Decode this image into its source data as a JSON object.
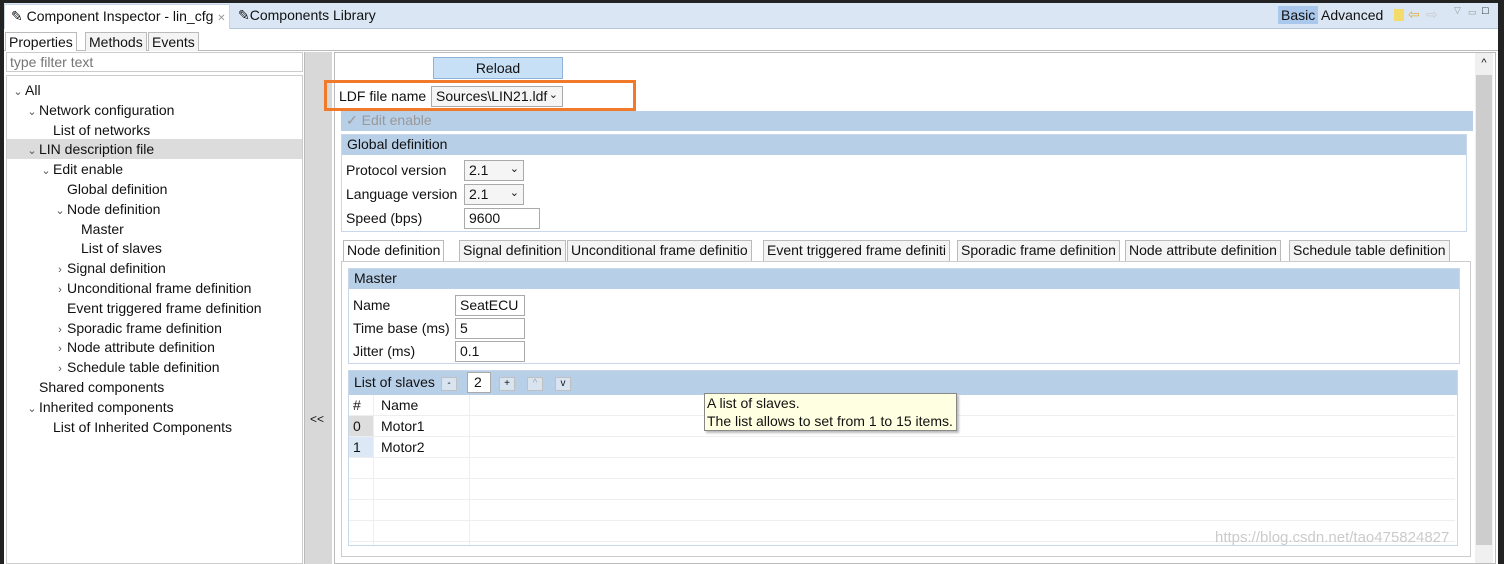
{
  "tabs": {
    "inspector": "Component Inspector - lin_cfg",
    "library": "Components Library",
    "basic": "Basic",
    "advanced": "Advanced"
  },
  "prop_tabs": [
    "Properties",
    "Methods",
    "Events"
  ],
  "filter_placeholder": "type filter text",
  "tree": [
    {
      "label": "All",
      "depth": 0,
      "caret": "v"
    },
    {
      "label": "Network configuration",
      "depth": 1,
      "caret": "v"
    },
    {
      "label": "List of networks",
      "depth": 2,
      "caret": ""
    },
    {
      "label": "LIN description file",
      "depth": 1,
      "caret": "v",
      "selected": true
    },
    {
      "label": "Edit enable",
      "depth": 2,
      "caret": "v"
    },
    {
      "label": "Global definition",
      "depth": 3,
      "caret": ""
    },
    {
      "label": "Node definition",
      "depth": 3,
      "caret": "v"
    },
    {
      "label": "Master",
      "depth": 4,
      "caret": ""
    },
    {
      "label": "List of slaves",
      "depth": 4,
      "caret": ""
    },
    {
      "label": "Signal definition",
      "depth": 3,
      "caret": ">"
    },
    {
      "label": "Unconditional frame definition",
      "depth": 3,
      "caret": ">"
    },
    {
      "label": "Event triggered frame definition",
      "depth": 3,
      "caret": ""
    },
    {
      "label": "Sporadic frame definition",
      "depth": 3,
      "caret": ">"
    },
    {
      "label": "Node attribute definition",
      "depth": 3,
      "caret": ">"
    },
    {
      "label": "Schedule table definition",
      "depth": 3,
      "caret": ">"
    },
    {
      "label": "Shared components",
      "depth": 1,
      "caret": ""
    },
    {
      "label": "Inherited components",
      "depth": 1,
      "caret": "v"
    },
    {
      "label": "List of Inherited Components",
      "depth": 2,
      "caret": ""
    }
  ],
  "collapse_label": "<<",
  "reload": "Reload",
  "ldf": {
    "label": "LDF file name",
    "value": "Sources\\LIN21.ldf"
  },
  "edit_enable": "Edit enable",
  "global": {
    "title": "Global definition",
    "protocol_label": "Protocol version",
    "protocol": "2.1",
    "language_label": "Language version",
    "language": "2.1",
    "speed_label": "Speed (bps)",
    "speed": "9600"
  },
  "inner_tabs": [
    "Node definition",
    "Signal definition",
    "Unconditional frame definitio",
    "Event triggered frame definiti",
    "Sporadic frame definition",
    "Node attribute definition",
    "Schedule table definition"
  ],
  "master": {
    "title": "Master",
    "name_label": "Name",
    "name": "SeatECU",
    "timebase_label": "Time base (ms)",
    "timebase": "5",
    "jitter_label": "Jitter (ms)",
    "jitter": "0.1"
  },
  "slaves": {
    "title": "List of slaves",
    "minus": "-",
    "count": "2",
    "plus": "+",
    "up": "^",
    "down": "v",
    "col_num": "#",
    "col_name": "Name",
    "rows": [
      {
        "num": "0",
        "name": "Motor1"
      },
      {
        "num": "1",
        "name": "Motor2"
      }
    ]
  },
  "tooltip": {
    "line1": "A list of slaves.",
    "line2": "The list allows to set from 1 to 15 items."
  },
  "watermark": "https://blog.csdn.net/tao475824827",
  "highlight_color": "#f07a2a"
}
